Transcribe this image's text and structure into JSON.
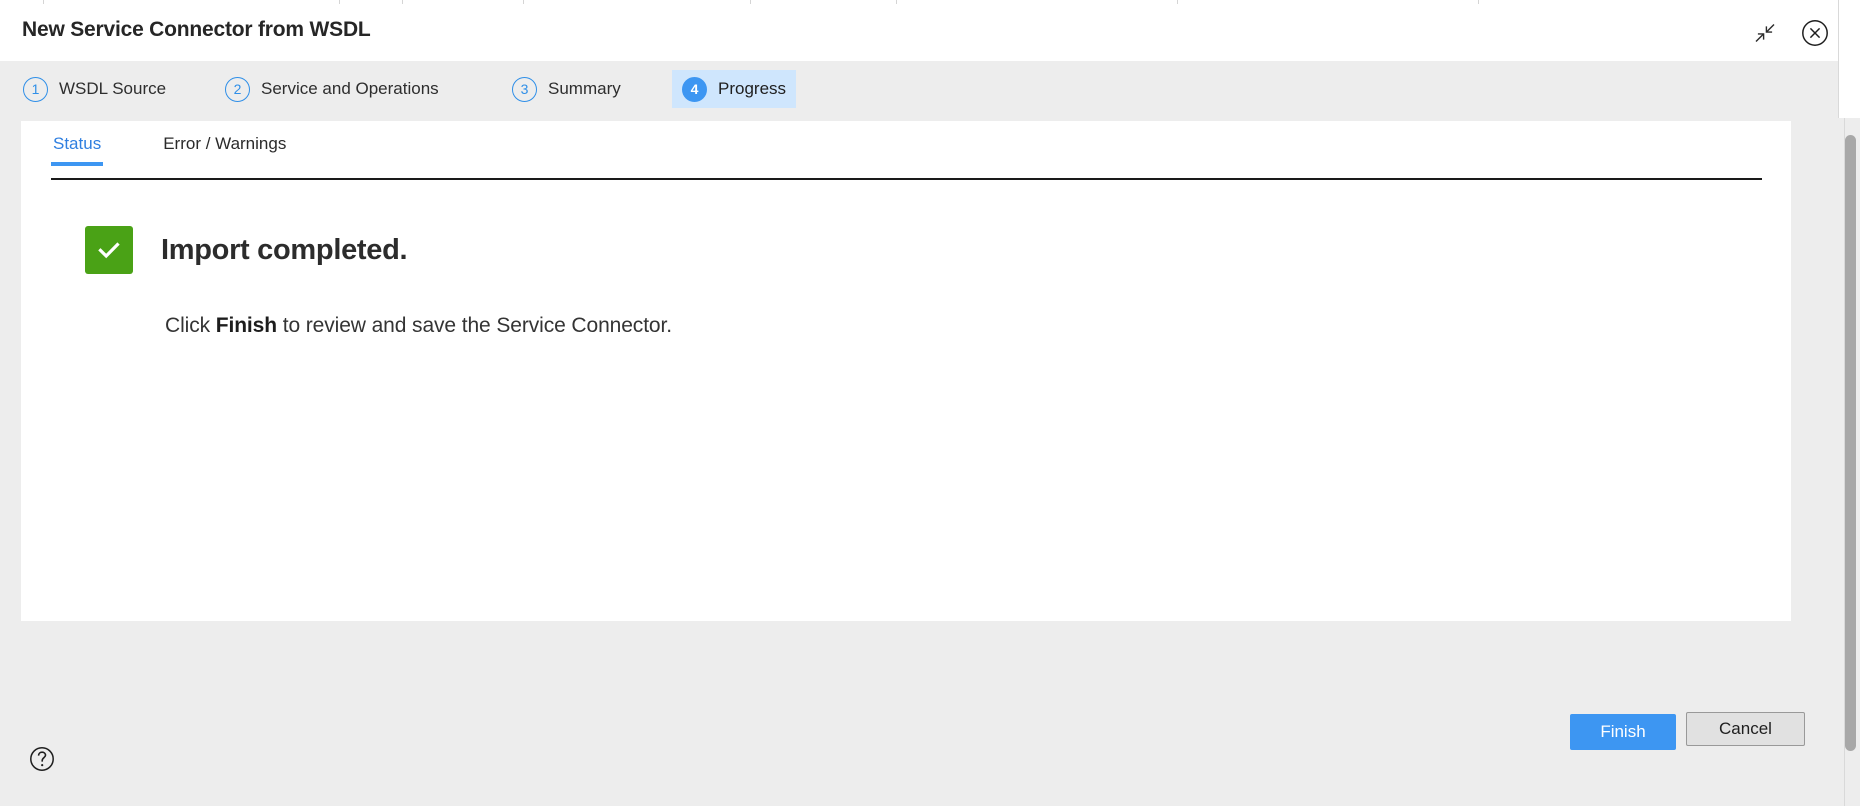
{
  "dialog": {
    "title": "New Service Connector from WSDL",
    "restore_icon": "collapse-arrows-icon",
    "close_icon": "close-circle-icon",
    "help_icon": "help-circle-icon"
  },
  "steps": [
    {
      "number": "1",
      "label": "WSDL Source",
      "active": false
    },
    {
      "number": "2",
      "label": "Service and Operations",
      "active": false
    },
    {
      "number": "3",
      "label": "Summary",
      "active": false
    },
    {
      "number": "4",
      "label": "Progress",
      "active": true
    }
  ],
  "tabs": [
    {
      "label": "Status",
      "active": true
    },
    {
      "label": "Error / Warnings",
      "active": false
    }
  ],
  "status": {
    "icon": "check-mark-icon",
    "title": "Import completed.",
    "message_prefix": "Click ",
    "message_bold": "Finish",
    "message_suffix": " to review and save the Service Connector."
  },
  "footer": {
    "finish_label": "Finish",
    "cancel_label": "Cancel"
  },
  "colors": {
    "accent_blue": "#3d96f2",
    "step_active_bg": "#cfe6fd",
    "success_green": "#4aa216",
    "dialog_bg": "#ededed",
    "panel_bg": "#ffffff",
    "tab_active_text": "#2f7fe0"
  }
}
